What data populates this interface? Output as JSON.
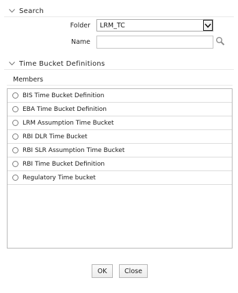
{
  "search_section": {
    "title": "Search",
    "folder_label": "Folder",
    "folder_value": "LRM_TC",
    "name_label": "Name",
    "name_value": "",
    "search_icon": "magnifier-icon"
  },
  "time_bucket_section": {
    "title": "Time Bucket Definitions",
    "members_label": "Members",
    "members": [
      {
        "label": "BIS Time Bucket Definition",
        "selected": false
      },
      {
        "label": "EBA Time Bucket Definition",
        "selected": false
      },
      {
        "label": "LRM Assumption Time Bucket",
        "selected": false
      },
      {
        "label": "RBI DLR Time Bucket",
        "selected": false
      },
      {
        "label": "RBI SLR Assumption Time Bucket",
        "selected": false
      },
      {
        "label": "RBI Time Bucket Definition",
        "selected": false
      },
      {
        "label": "Regulatory Time bucket",
        "selected": false
      }
    ]
  },
  "buttons": {
    "ok_label": "OK",
    "close_label": "Close"
  },
  "colors": {
    "border": "#b8b8b8",
    "row_divider": "#dcdcdc",
    "text": "#1a1a1a"
  }
}
